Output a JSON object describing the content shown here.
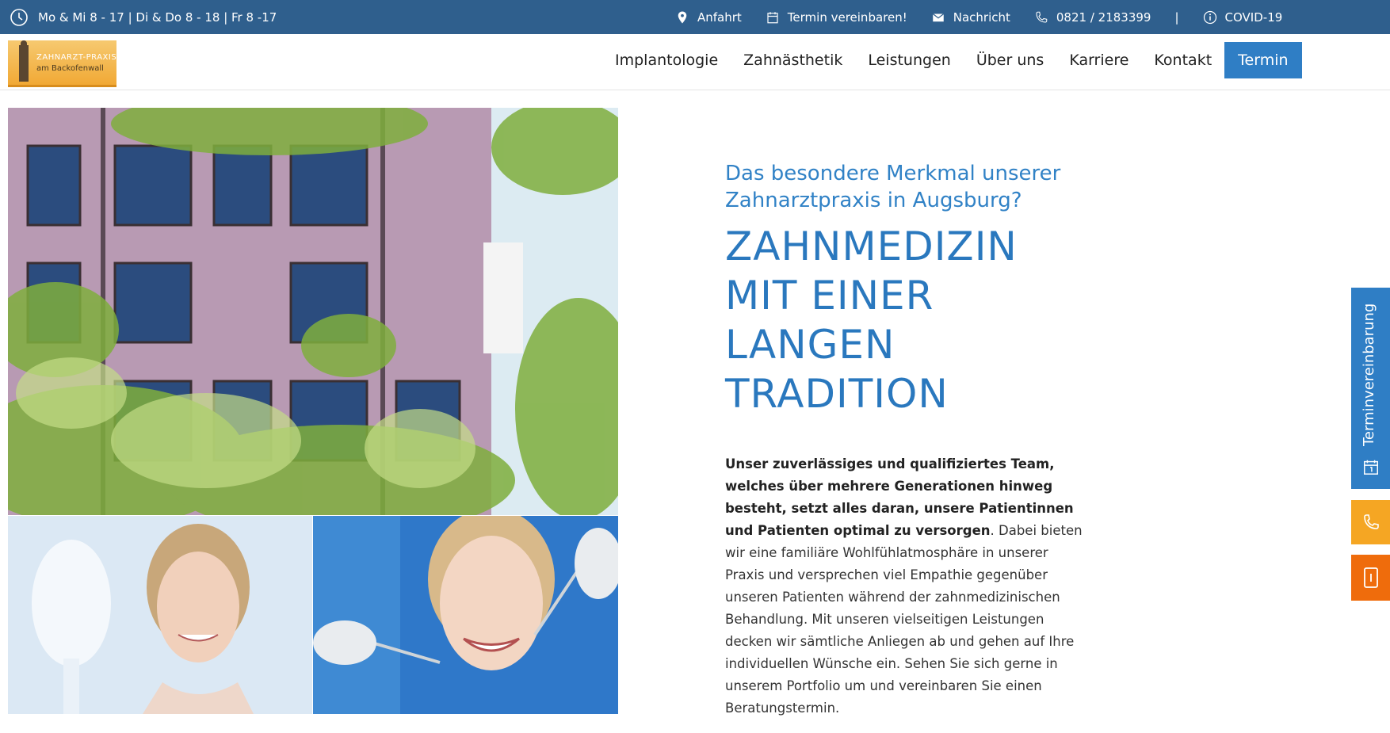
{
  "topbar": {
    "hours": "Mo & Mi 8 - 17 | Di & Do 8 - 18 | Fr 8 -17",
    "items": [
      {
        "icon": "map-pin-icon",
        "label": "Anfahrt"
      },
      {
        "icon": "calendar-icon",
        "label": "Termin vereinbaren!"
      },
      {
        "icon": "envelope-icon",
        "label": "Nachricht"
      },
      {
        "icon": "phone-icon",
        "label": "0821 / 2183399"
      }
    ],
    "separator": "|",
    "covid": "COVID-19"
  },
  "logo": {
    "line1": "ZAHNARZT-PRAXIS",
    "line2": "am Backofenwall"
  },
  "nav": {
    "items": [
      "Implantologie",
      "Zahnästhetik",
      "Leistungen",
      "Über uns",
      "Karriere",
      "Kontakt"
    ],
    "cta": "Termin"
  },
  "main": {
    "subtitle": "Das besondere Merkmal unserer Zahnarztpraxis in Augsburg?",
    "headline": "ZAHNMEDIZIN MIT EINER LANGEN TRADITION",
    "body_bold": "Unser zuverlässiges und qualifiziertes Team, welches über mehrere Generationen hinweg besteht, setzt alles daran, unsere Patientinnen und Patienten optimal zu versorgen",
    "body_rest": ". Dabei bieten wir eine familiäre Wohlfühlatmosphäre in unserer Praxis und versprechen viel Empathie gegenüber unseren Patienten während der zahnmedizinischen Behandlung. Mit unseren vielseitigen Leistungen decken wir sämtliche Anliegen ab und gehen auf Ihre individuellen Wünsche ein. Sehen Sie sich gerne in unserem Portfolio um und vereinbaren Sie einen Beratungstermin."
  },
  "side": {
    "termin_label": "Terminvereinbarung"
  },
  "colors": {
    "topbar": "#2f5f8d",
    "accent_blue": "#2f7ec5",
    "orange": "#f5a623",
    "dark_orange": "#ef6c0c"
  }
}
